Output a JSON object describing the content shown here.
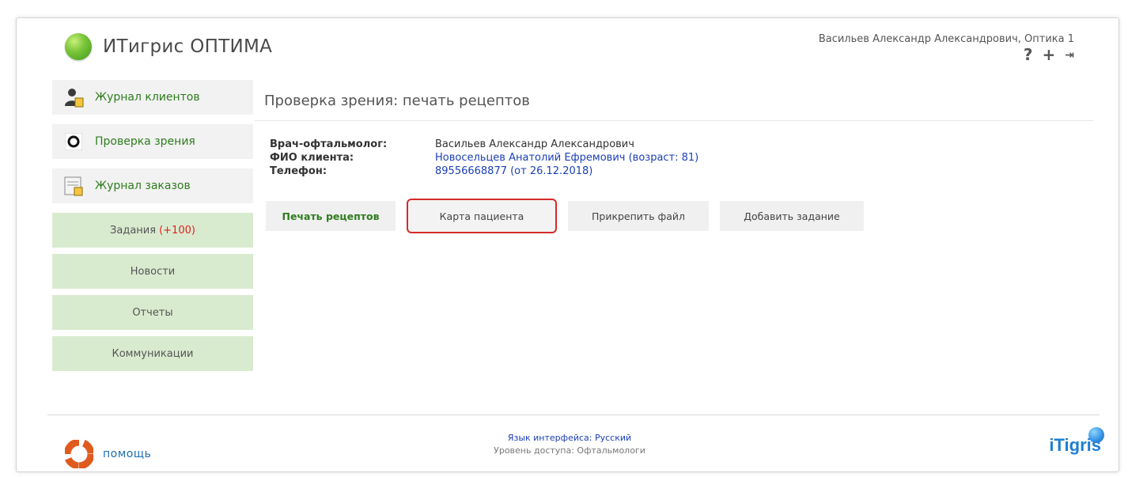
{
  "app": {
    "title": "ИТигрис ОПТИМА"
  },
  "user": {
    "name": "Васильев Александр Александрович, Оптика 1"
  },
  "header_icons": [
    "help-icon",
    "plus-icon",
    "logout-icon"
  ],
  "header_glyphs": {
    "help": "?",
    "add": "+",
    "logout": "⇥"
  },
  "sidebar": {
    "items": [
      {
        "label": "Журнал клиентов",
        "icon": "client-journal-icon"
      },
      {
        "label": "Проверка зрения",
        "icon": "eye-check-icon"
      },
      {
        "label": "Журнал заказов",
        "icon": "orders-journal-icon"
      }
    ],
    "green_items": [
      {
        "label": "Задания",
        "badge": "(+100)"
      },
      {
        "label": "Новости",
        "badge": ""
      },
      {
        "label": "Отчеты",
        "badge": ""
      },
      {
        "label": "Коммуникации",
        "badge": ""
      }
    ]
  },
  "main": {
    "title": "Проверка зрения: печать рецептов",
    "info": [
      {
        "key": "Врач-офтальмолог:",
        "value": "Васильев Александр Александрович"
      },
      {
        "key": "ФИО клиента:",
        "value": "Новосельцев Анатолий Ефремович (возраст: 81)"
      },
      {
        "key": "Телефон:",
        "value": "89556668877 (от 26.12.2018)"
      }
    ],
    "tabs": [
      {
        "label": "Печать рецептов"
      },
      {
        "label": "Карта пациента"
      },
      {
        "label": "Прикрепить файл"
      },
      {
        "label": "Добавить задание"
      }
    ]
  },
  "footer": {
    "help_label": "помощь",
    "language": "Язык интерфейса: Русский",
    "access": "Уровень доступа: Офтальмологи",
    "brand": "iTigris"
  },
  "colors": {
    "accent_green": "#2e7d1d",
    "sidebar_green": "#d9ebcf",
    "link_blue": "#1a3fb5",
    "highlight_red": "#d42b2b",
    "badge_red": "#e02020"
  }
}
